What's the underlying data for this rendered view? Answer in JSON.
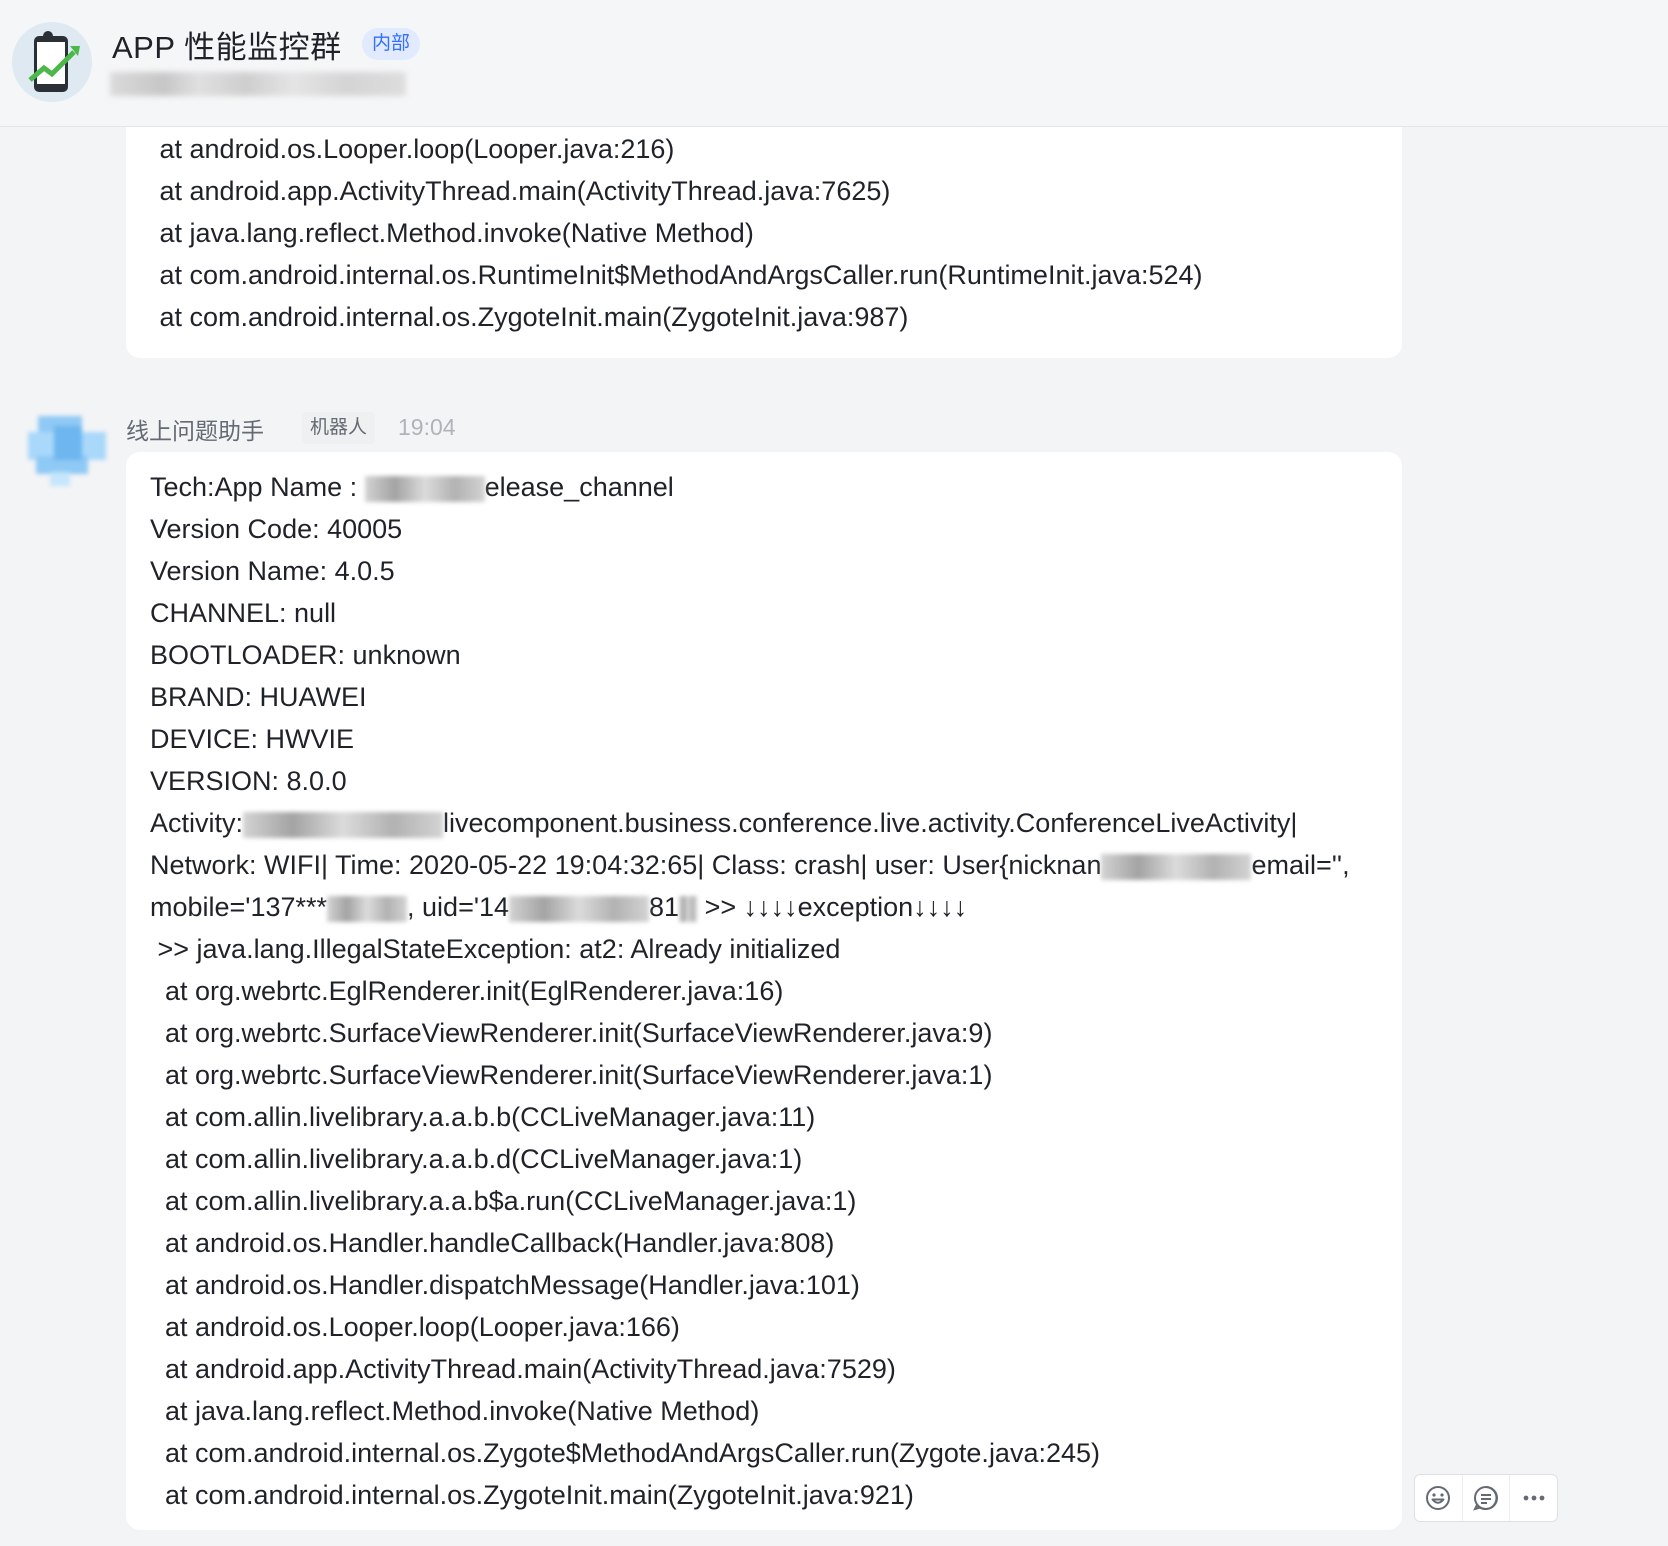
{
  "header": {
    "title": "APP 性能监控群",
    "tag": "内部"
  },
  "previous_message": {
    "lines": [
      " at android.os.Looper.loop(Looper.java:216)",
      " at android.app.ActivityThread.main(ActivityThread.java:7625)",
      " at java.lang.reflect.Method.invoke(Native Method)",
      " at com.android.internal.os.RuntimeInit$MethodAndArgsCaller.run(RuntimeInit.java:524)",
      " at com.android.internal.os.ZygoteInit.main(ZygoteInit.java:987)"
    ]
  },
  "message": {
    "sender": "线上问题助手",
    "badge": "机器人",
    "time": "19:04",
    "app_name_prefix": "Tech:App Name : ",
    "app_name_suffix": "elease_channel",
    "lines_a": [
      "Version Code: 40005",
      "Version Name: 4.0.5",
      "CHANNEL: null",
      "BOOTLOADER: unknown",
      "BRAND: HUAWEI",
      "DEVICE: HWVIE",
      "VERSION: 8.0.0"
    ],
    "activity_prefix": "Activity:",
    "activity_suffix": "livecomponent.business.conference.live.activity.ConferenceLiveActivity|",
    "network_prefix": "Network: WIFI| Time: 2020-05-22 19:04:32:65| Class: crash| user: User{nicknan",
    "network_suffix": "email='',",
    "mobile_prefix": "mobile='137***",
    "mobile_mid": ", uid='14",
    "mobile_mid2": "81",
    "mobile_suffix": " >> ↓↓↓↓exception↓↓↓↓",
    "lines_b": [
      " >> java.lang.IllegalStateException: at2: Already initialized",
      "  at org.webrtc.EglRenderer.init(EglRenderer.java:16)",
      "  at org.webrtc.SurfaceViewRenderer.init(SurfaceViewRenderer.java:9)",
      "  at org.webrtc.SurfaceViewRenderer.init(SurfaceViewRenderer.java:1)",
      "  at com.allin.livelibrary.a.a.b.b(CCLiveManager.java:11)",
      "  at com.allin.livelibrary.a.a.b.d(CCLiveManager.java:1)",
      "  at com.allin.livelibrary.a.a.b$a.run(CCLiveManager.java:1)",
      "  at android.os.Handler.handleCallback(Handler.java:808)",
      "  at android.os.Handler.dispatchMessage(Handler.java:101)",
      "  at android.os.Looper.loop(Looper.java:166)",
      "  at android.app.ActivityThread.main(ActivityThread.java:7529)",
      "  at java.lang.reflect.Method.invoke(Native Method)",
      "  at com.android.internal.os.Zygote$MethodAndArgsCaller.run(Zygote.java:245)",
      "  at com.android.internal.os.ZygoteInit.main(ZygoteInit.java:921)"
    ]
  },
  "actions": {
    "reaction": "emoji-reaction-icon",
    "reply": "reply-icon",
    "more": "more-icon"
  }
}
